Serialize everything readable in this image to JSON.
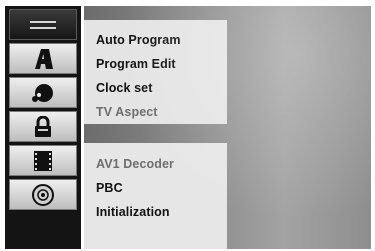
{
  "sidebar": {
    "items": [
      {
        "icon": "menu-lines-icon",
        "active": true
      },
      {
        "icon": "letter-a-icon",
        "active": false
      },
      {
        "icon": "audio-icon",
        "active": false
      },
      {
        "icon": "lock-icon",
        "active": false
      },
      {
        "icon": "film-icon",
        "active": false
      },
      {
        "icon": "disc-icon",
        "active": false
      }
    ]
  },
  "menu": {
    "group1": [
      {
        "label": "Auto Program",
        "enabled": true
      },
      {
        "label": "Program Edit",
        "enabled": true
      },
      {
        "label": "Clock set",
        "enabled": true
      },
      {
        "label": "TV Aspect",
        "enabled": false
      }
    ],
    "group2": [
      {
        "label": "AV1 Decoder",
        "enabled": false
      },
      {
        "label": "PBC",
        "enabled": true
      },
      {
        "label": "Initialization",
        "enabled": true
      }
    ]
  },
  "colors": {
    "enabled_text": "#111111",
    "disabled_text": "#6e6e6e",
    "sidebar_bg": "#141414"
  }
}
